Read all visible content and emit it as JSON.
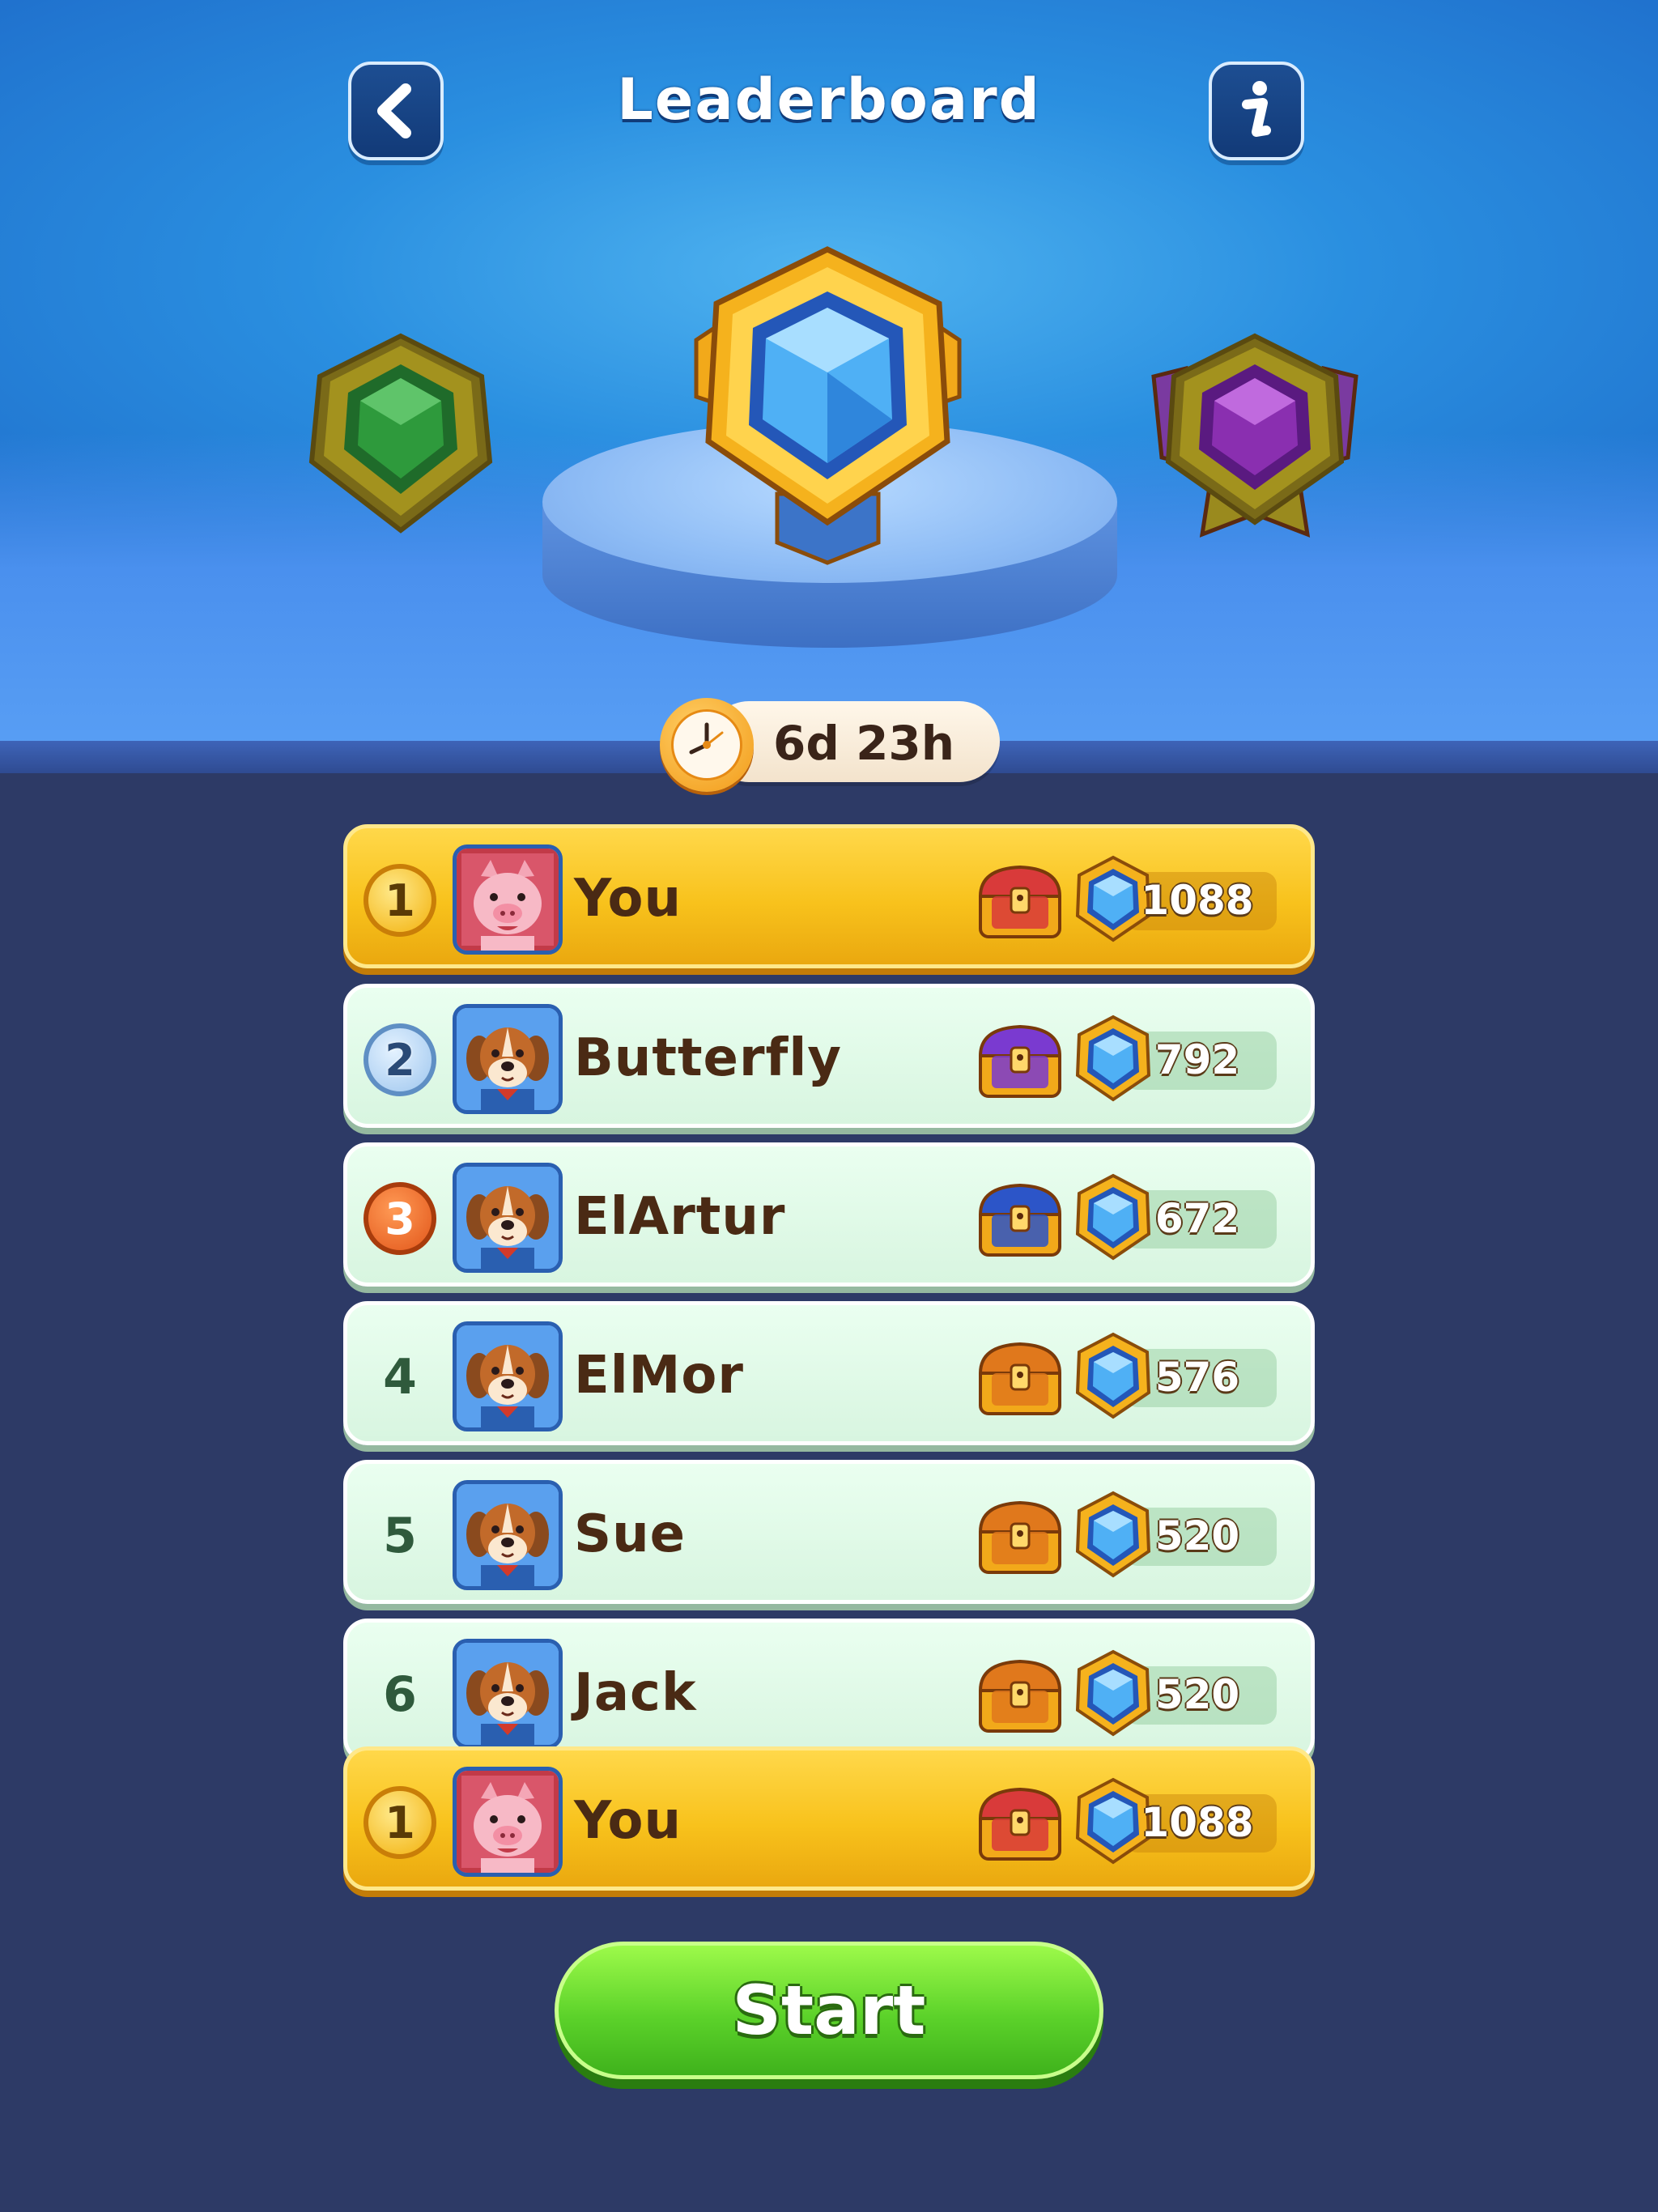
{
  "header": {
    "title": "Leaderboard",
    "back_icon": "chevron-left-icon",
    "info_icon": "info-icon"
  },
  "league": {
    "left_badge_color": "#2e9a3c",
    "center_badge_color": "#4fb0f5",
    "right_badge_color": "#8a2fb0"
  },
  "timer": {
    "text": "6d 23h",
    "icon": "clock-icon"
  },
  "rows": [
    {
      "rank": "1",
      "name": "You",
      "score": "1088",
      "chest_color": "#d93a3a",
      "style": "gold",
      "avatar": "pig"
    },
    {
      "rank": "2",
      "name": "Butterfly",
      "score": "792",
      "chest_color": "#7a3ad0",
      "style": "green",
      "avatar": "dog"
    },
    {
      "rank": "3",
      "name": "ElArtur",
      "score": "672",
      "chest_color": "#2c55c8",
      "style": "green",
      "avatar": "dog"
    },
    {
      "rank": "4",
      "name": "ElMor",
      "score": "576",
      "chest_color": "#e0781c",
      "style": "green",
      "avatar": "dog"
    },
    {
      "rank": "5",
      "name": "Sue",
      "score": "520",
      "chest_color": "#e0781c",
      "style": "green",
      "avatar": "dog"
    },
    {
      "rank": "6",
      "name": "Jack",
      "score": "520",
      "chest_color": "#e0781c",
      "style": "green",
      "avatar": "dog"
    }
  ],
  "pinned_row": {
    "rank": "1",
    "name": "You",
    "score": "1088",
    "chest_color": "#d93a3a",
    "avatar": "pig"
  },
  "start_button": {
    "label": "Start"
  }
}
